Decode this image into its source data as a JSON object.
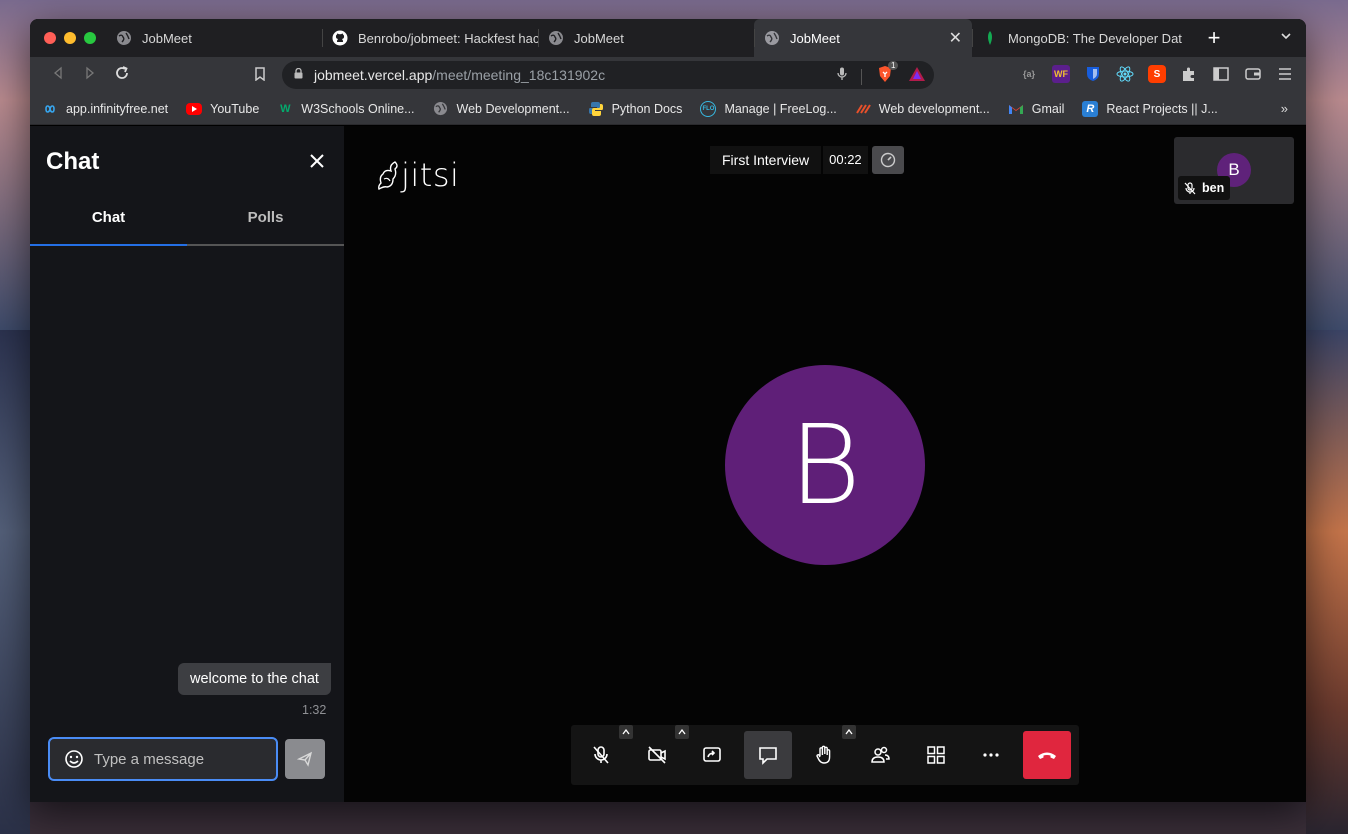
{
  "browser": {
    "tabs": [
      {
        "title": "JobMeet",
        "icon": "globe-icon"
      },
      {
        "title": "Benrobo/jobmeet: Hackfest hac",
        "icon": "github-icon"
      },
      {
        "title": "JobMeet",
        "icon": "globe-icon"
      },
      {
        "title": "JobMeet",
        "icon": "globe-icon",
        "active": true
      },
      {
        "title": "MongoDB: The Developer Data",
        "icon": "mongodb-leaf-icon"
      }
    ],
    "new_tab": "+",
    "url_host": "jobmeet.vercel.app",
    "url_path": "/meet/meeting_18c131902c",
    "brave_badge": "1",
    "bookmarks": [
      {
        "label": "app.infinityfree.net",
        "icon": "infinity-icon"
      },
      {
        "label": "YouTube",
        "icon": "youtube-icon"
      },
      {
        "label": "W3Schools Online...",
        "icon": "w3schools-icon"
      },
      {
        "label": "Web Development...",
        "icon": "globe-icon"
      },
      {
        "label": "Python Docs",
        "icon": "python-icon"
      },
      {
        "label": "Manage | FreeLog...",
        "icon": "freelogo-icon"
      },
      {
        "label": "Web development...",
        "icon": "webdev-icon"
      },
      {
        "label": "Gmail",
        "icon": "gmail-icon"
      },
      {
        "label": "React Projects || J...",
        "icon": "react-projects-icon"
      }
    ],
    "bookmarks_more": "»"
  },
  "chat": {
    "title": "Chat",
    "tabs": [
      "Chat",
      "Polls"
    ],
    "messages": [
      {
        "text": "welcome to the chat",
        "time": "1:32"
      }
    ],
    "input_placeholder": "Type a message"
  },
  "meeting": {
    "logo_text": "jitsi",
    "name": "First Interview",
    "timer": "00:22",
    "main_avatar_letter": "B",
    "thumbnail": {
      "avatar_letter": "B",
      "name": "ben",
      "muted": true
    }
  },
  "colors": {
    "avatar": "#5f1f78",
    "accent_blue": "#246fe5",
    "hangup_red": "#e0263e"
  },
  "toolbar_buttons": [
    "microphone-muted-icon",
    "camera-off-icon",
    "screen-share-icon",
    "chat-icon",
    "raise-hand-icon",
    "participants-icon",
    "tile-view-icon",
    "more-actions-icon",
    "hangup-icon"
  ]
}
